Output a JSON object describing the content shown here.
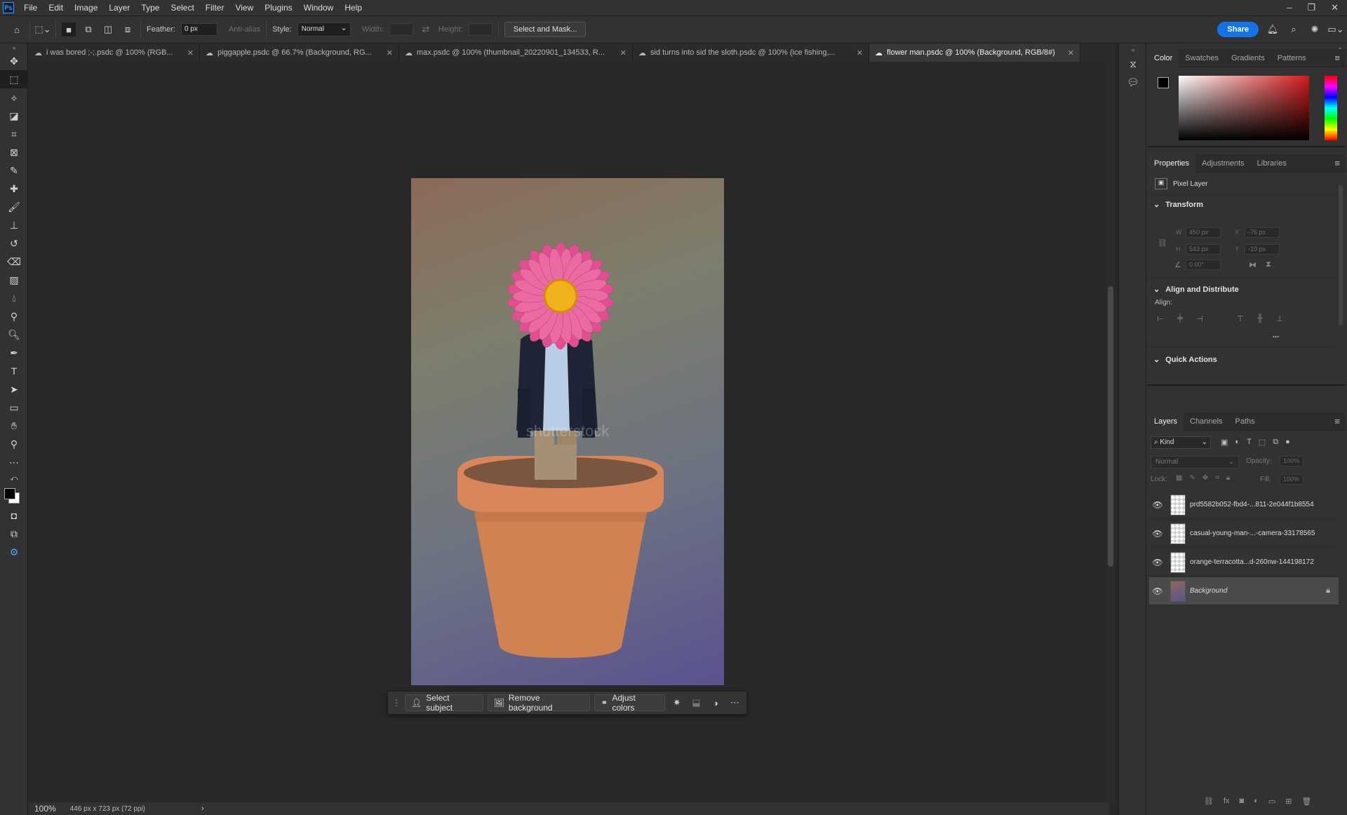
{
  "app": {
    "logo": "Ps"
  },
  "menu": [
    "File",
    "Edit",
    "Image",
    "Layer",
    "Type",
    "Select",
    "Filter",
    "View",
    "Plugins",
    "Window",
    "Help"
  ],
  "options_bar": {
    "feather_label": "Feather:",
    "feather_value": "0 px",
    "anti_alias_label": "Anti-alias",
    "style_label": "Style:",
    "style_value": "Normal",
    "width_label": "Width:",
    "height_label": "Height:",
    "select_mask_label": "Select and Mask...",
    "share_label": "Share"
  },
  "tabs": [
    {
      "label": "i was bored ;-;.psdc @ 100% (RGB...",
      "active": false
    },
    {
      "label": "piggapple.psdc @ 66.7% (Background, RG...",
      "active": false
    },
    {
      "label": "max.psdc @ 100% (thumbnail_20220901_134533, R...",
      "active": false
    },
    {
      "label": "sid turns into sid the sloth.psdc @ 100% (ice fishing,...",
      "active": false
    },
    {
      "label": "flower man.psdc @ 100% (Background, RGB/8#)",
      "active": true
    }
  ],
  "canvas": {
    "watermark": "shutterstock"
  },
  "context_bar": {
    "select_subject": "Select subject",
    "remove_background": "Remove background",
    "adjust_colors": "Adjust colors"
  },
  "status": {
    "zoom": "100%",
    "doc_info": "446 px x 723 px (72 ppi)"
  },
  "color_panel": {
    "tabs": [
      "Color",
      "Swatches",
      "Gradients",
      "Patterns"
    ]
  },
  "properties_panel": {
    "tabs": [
      "Properties",
      "Adjustments",
      "Libraries"
    ],
    "layer_type": "Pixel Layer",
    "transform_title": "Transform",
    "w_label": "W",
    "w_value": "450 px",
    "h_label": "H",
    "h_value": "543 px",
    "x_label": "X",
    "x_value": "-76 px",
    "y_label": "Y",
    "y_value": "-10 px",
    "angle_value": "0.00°",
    "align_title": "Align and Distribute",
    "align_label": "Align:",
    "more_label": "...",
    "quick_actions_title": "Quick Actions"
  },
  "layers_panel": {
    "tabs": [
      "Layers",
      "Channels",
      "Paths"
    ],
    "kind_label": "Kind",
    "blend_mode": "Normal",
    "opacity_label": "Opacity:",
    "opacity_value": "100%",
    "lock_label": "Lock:",
    "fill_label": "Fill:",
    "fill_value": "100%",
    "layers": [
      {
        "name": "prd5582b052-fbd4-...811-2e044f1b8554",
        "selected": false
      },
      {
        "name": "casual-young-man-...-camera-33178565",
        "selected": false
      },
      {
        "name": "orange-terracotta...d-260nw-144198172",
        "selected": false
      },
      {
        "name": "Background",
        "selected": true
      }
    ]
  },
  "colors": {
    "accent": "#1473e6",
    "flower_pink": "#e0508f",
    "flower_center": "#f0b21a",
    "pot": "#d9875a"
  }
}
